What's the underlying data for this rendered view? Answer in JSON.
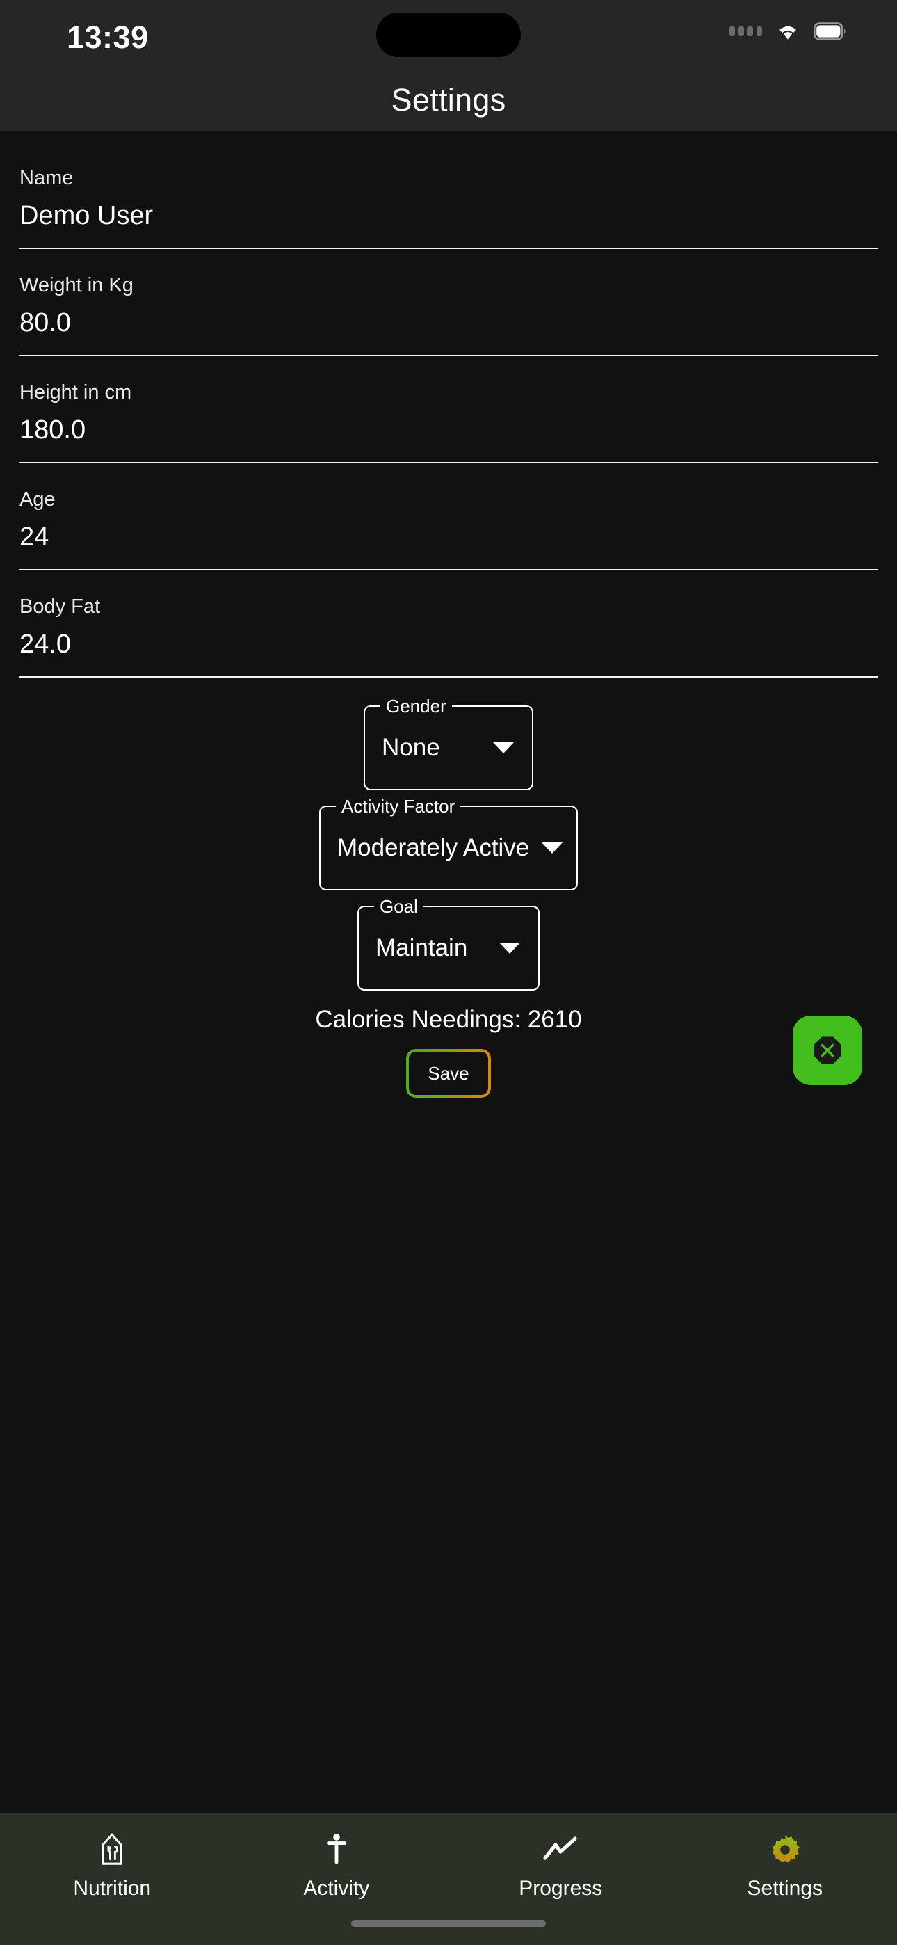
{
  "status_bar": {
    "time": "13:39",
    "cellular_icon": "cellular-dots-icon",
    "wifi_icon": "wifi-icon",
    "battery_icon": "battery-icon"
  },
  "header": {
    "title": "Settings"
  },
  "form": {
    "fields": [
      {
        "label": "Name",
        "value": "Demo User"
      },
      {
        "label": "Weight in Kg",
        "value": "80.0"
      },
      {
        "label": "Height in cm",
        "value": "180.0"
      },
      {
        "label": "Age",
        "value": "24"
      },
      {
        "label": "Body Fat",
        "value": "24.0"
      }
    ]
  },
  "selects": [
    {
      "legend": "Gender",
      "value": "None",
      "caret_icon": "chevron-down-icon"
    },
    {
      "legend": "Activity Factor",
      "value": "Moderately Active",
      "caret_icon": "chevron-down-icon"
    },
    {
      "legend": "Goal",
      "value": "Maintain",
      "caret_icon": "chevron-down-icon"
    }
  ],
  "summary": {
    "calories_text": "Calories Needings: 2610"
  },
  "actions": {
    "save_label": "Save",
    "fab_icon": "close-octagon-icon"
  },
  "bottom_nav": {
    "items": [
      {
        "label": "Nutrition",
        "icon": "restaurant-icon",
        "active": false
      },
      {
        "label": "Activity",
        "icon": "person-icon",
        "active": false
      },
      {
        "label": "Progress",
        "icon": "trending-up-icon",
        "active": false
      },
      {
        "label": "Settings",
        "icon": "gear-icon",
        "active": true
      }
    ]
  },
  "colors": {
    "accent_green": "#43bf1d",
    "accent_orange": "#d98a08",
    "nav_background": "#2b3126",
    "header_background": "#262626",
    "body_background": "#111111"
  }
}
